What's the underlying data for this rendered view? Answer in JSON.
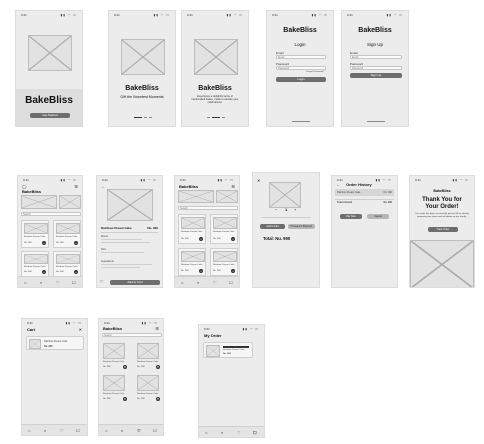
{
  "status": {
    "time": "9:41",
    "indicators": "▮▮ ◠ ▭"
  },
  "brand": "BakeBliss",
  "splash": {
    "button": "Get Started"
  },
  "onboarding": {
    "tagline1": "Gift the Sweetest Moments",
    "tagline2": "Experience a delightful array of handcrafted bakes, made to elevate your celebrations."
  },
  "login": {
    "title": "Login",
    "email_label": "Email",
    "email_placeholder": "Email",
    "password_label": "Password",
    "password_placeholder": "Password",
    "forgot": "Forgot Password?",
    "button": "Login"
  },
  "signup": {
    "title": "Sign Up",
    "email_label": "Email",
    "email_placeholder": "Email",
    "password_label": "Password",
    "password_placeholder": "Password",
    "button": "Sign Up"
  },
  "home": {
    "search_placeholder": "Search",
    "products": [
      {
        "name": "Rainbow Dream Cake",
        "price": "Nu. 990"
      },
      {
        "name": "Rainbow Dream Cake",
        "price": "Nu. 990"
      },
      {
        "name": "Rainbow Dream Cake",
        "price": "Nu. 990"
      },
      {
        "name": "Rainbow Dream Cake",
        "price": "Nu. 990"
      }
    ]
  },
  "detail": {
    "title": "Rainbow Dream Cake",
    "price": "Nu. 990",
    "section1": "Flavor",
    "section2": "Size",
    "section3": "Ingredients",
    "button": "Add to Cart"
  },
  "quantity": {
    "value": "1",
    "add_button": "Add to Cart",
    "buy_button": "Proceed to Payment",
    "total": "Total: Nu. 990"
  },
  "order_history": {
    "title": "Order History",
    "item": "Rainbow Dream Cake",
    "item_price": "Nu. 990",
    "total_label": "Total Amount",
    "total_value": "Nu. 990",
    "btn1": "Pay Now",
    "btn2": "Cancel"
  },
  "thanks": {
    "title_line1": "Thank You for",
    "title_line2": "Your Order!",
    "body": "Your order has been successfully placed. We're already preparing your treats and will deliver to you shortly.",
    "button": "Track Order"
  },
  "cart": {
    "title": "Cart",
    "item": "Rainbow Dream Cake",
    "item_price": "Nu. 990"
  },
  "my_order": {
    "title": "My Order",
    "item": "Rainbow Dream Cake",
    "item_price": "Nu. 990"
  },
  "tab_icons": [
    "⌂",
    "⌕",
    "♡",
    "☐"
  ]
}
